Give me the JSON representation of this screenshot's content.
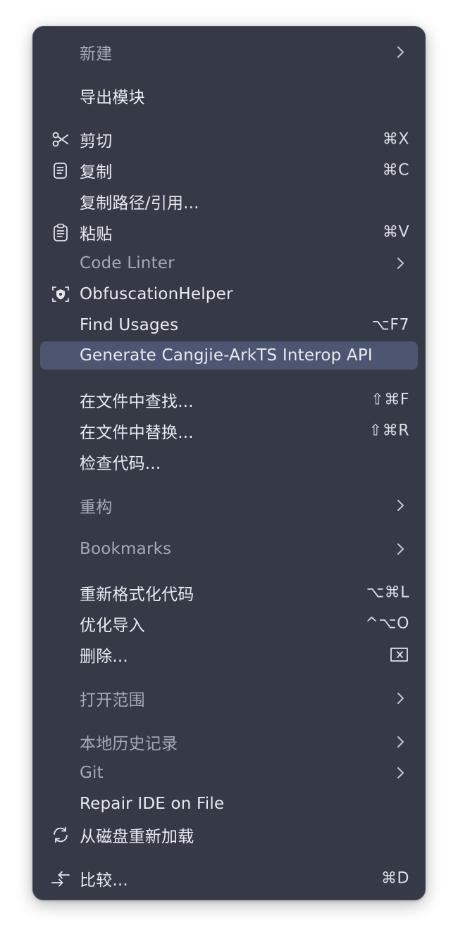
{
  "menu": {
    "items": [
      {
        "label": "新建"
      },
      {
        "label": "导出模块"
      },
      {
        "label": "剪切",
        "shortcut": "⌘X",
        "icon": "scissors-icon"
      },
      {
        "label": "复制",
        "shortcut": "⌘C",
        "icon": "copy-icon"
      },
      {
        "label": "复制路径/引用..."
      },
      {
        "label": "粘贴",
        "shortcut": "⌘V",
        "icon": "paste-icon"
      },
      {
        "label": "Code Linter"
      },
      {
        "label": "ObfuscationHelper",
        "icon": "shield-icon"
      },
      {
        "label": "Find Usages",
        "shortcut": "⌥F7"
      },
      {
        "label": "Generate Cangjie-ArkTS Interop API"
      },
      {
        "label": "在文件中查找...",
        "shortcut": "⇧⌘F"
      },
      {
        "label": "在文件中替换...",
        "shortcut": "⇧⌘R"
      },
      {
        "label": "检查代码..."
      },
      {
        "label": "重构"
      },
      {
        "label": "Bookmarks"
      },
      {
        "label": "重新格式化代码",
        "shortcut": "⌥⌘L"
      },
      {
        "label": "优化导入",
        "shortcut": "^⌥O"
      },
      {
        "label": "删除...",
        "icon_shortcut": "delete-key-icon"
      },
      {
        "label": "打开范围"
      },
      {
        "label": "本地历史记录"
      },
      {
        "label": "Git"
      },
      {
        "label": "Repair IDE on File"
      },
      {
        "label": "从磁盘重新加载",
        "icon": "reload-icon"
      },
      {
        "label": "比较...",
        "shortcut": "⌘D",
        "icon": "compare-icon"
      }
    ]
  },
  "colors": {
    "menu_bg": "#363a47",
    "selected_bg": "#4d5571",
    "text": "#e9ebf0",
    "text_dim": "#a4a9b6"
  }
}
